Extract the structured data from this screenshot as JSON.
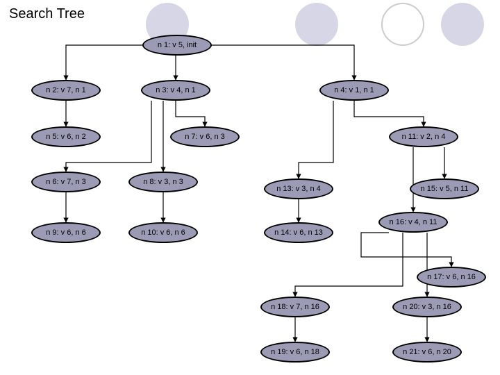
{
  "title": "Search Tree",
  "nodes": {
    "n1": "n 1: v 5, init",
    "n2": "n 2: v 7, n 1",
    "n3": "n 3: v 4, n 1",
    "n4": "n 4: v 1, n 1",
    "n5": "n 5: v 6, n 2",
    "n7": "n 7: v 6, n 3",
    "n11": "n 11: v 2, n 4",
    "n6": "n 6: v 7, n 3",
    "n8": "n 8: v 3, n 3",
    "n13": "n 13: v 3, n 4",
    "n15": "n 15: v 5, n 11",
    "n9": "n 9: v 6, n 6",
    "n10": "n 10: v 6, n 6",
    "n14": "n 14: v 6, n 13",
    "n16": "n 16: v 4, n 11",
    "n17": "n 17: v 6, n 16",
    "n18": "n 18: v 7, n 16",
    "n20": "n 20: v 3, n 16",
    "n19": "n 19: v 6, n 18",
    "n21": "n 21: v 6, n 20"
  }
}
